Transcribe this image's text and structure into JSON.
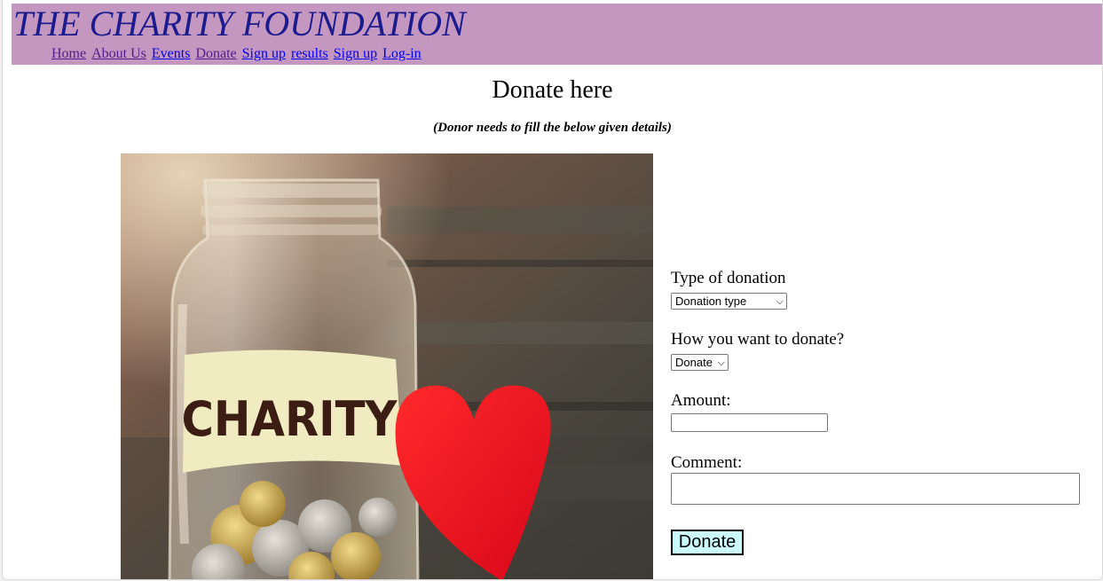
{
  "site": {
    "title": "THE CHARITY FOUNDATION"
  },
  "nav": {
    "items": [
      {
        "label": "Home"
      },
      {
        "label": "About Us"
      },
      {
        "label": "Events"
      },
      {
        "label": "Donate"
      },
      {
        "label": "Sign up"
      },
      {
        "label": "results"
      },
      {
        "label": "Sign up"
      },
      {
        "label": "Log-in"
      }
    ]
  },
  "page": {
    "heading": "Donate here",
    "subtitle": "(Donor needs to fill the below given details)"
  },
  "image": {
    "jar_label": "CHARITY"
  },
  "form": {
    "type_label": "Type of donation",
    "type_value": "Donation type",
    "how_label": "How you want to donate?",
    "how_value": "Donate",
    "amount_label": "Amount:",
    "amount_value": "",
    "comment_label": "Comment:",
    "comment_value": "",
    "submit_label": "Donate"
  },
  "colors": {
    "header_bg": "#c497c1",
    "title": "#1b1b8e",
    "link_visited": "#551a8b",
    "link_unvisited": "#0000ee",
    "button_bg": "#ccfbff"
  }
}
